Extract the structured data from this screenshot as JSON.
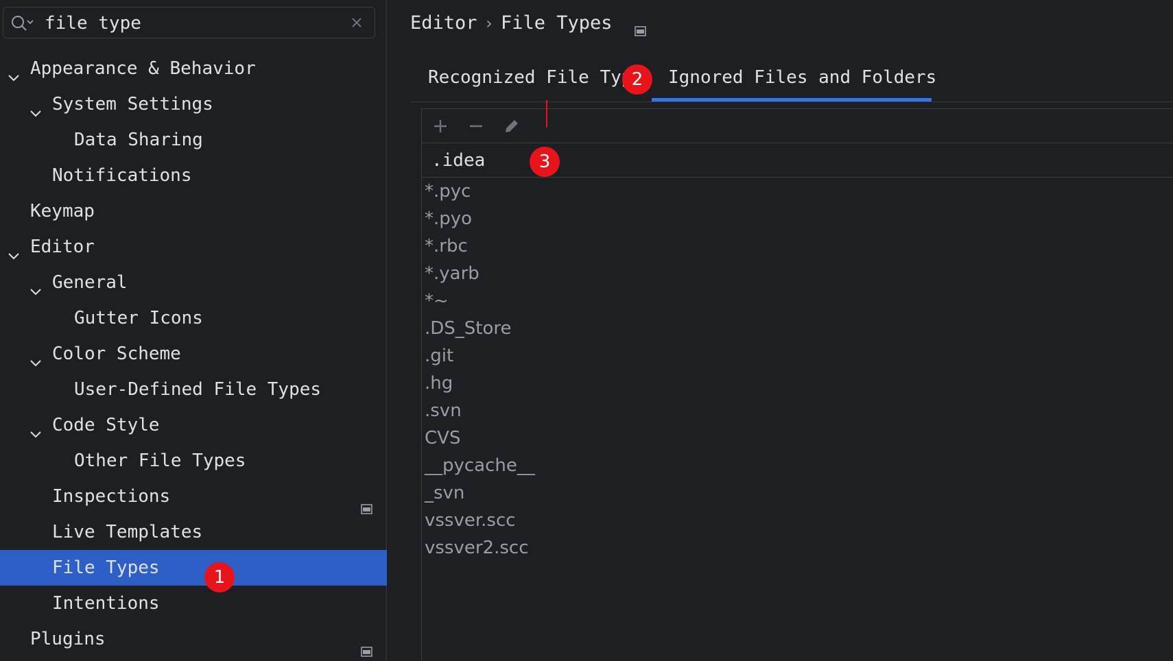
{
  "search": {
    "value": "file type",
    "icon": "search-icon"
  },
  "tree": {
    "items": [
      {
        "label": "Appearance & Behavior",
        "level": 0,
        "expanded": true
      },
      {
        "label": "System Settings",
        "level": 1,
        "expanded": true
      },
      {
        "label": "Data Sharing",
        "level": 2
      },
      {
        "label": "Notifications",
        "level": 1
      },
      {
        "label": "Keymap",
        "level": 0
      },
      {
        "label": "Editor",
        "level": 0,
        "expanded": true
      },
      {
        "label": "General",
        "level": 1,
        "expanded": true
      },
      {
        "label": "Gutter Icons",
        "level": 2
      },
      {
        "label": "Color Scheme",
        "level": 1,
        "expanded": true
      },
      {
        "label": "User-Defined File Types",
        "level": 2
      },
      {
        "label": "Code Style",
        "level": 1,
        "expanded": true
      },
      {
        "label": "Other File Types",
        "level": 2
      },
      {
        "label": "Inspections",
        "level": 1,
        "pinned": true
      },
      {
        "label": "Live Templates",
        "level": 1
      },
      {
        "label": "File Types",
        "level": 1,
        "selected": true
      },
      {
        "label": "Intentions",
        "level": 1
      },
      {
        "label": "Plugins",
        "level": 0,
        "pinned": true
      }
    ]
  },
  "breadcrumb": {
    "parent": "Editor",
    "separator": "›",
    "current": "File Types"
  },
  "tabs": [
    {
      "label": "Recognized File Types",
      "active": false
    },
    {
      "label": "Ignored Files and Folders",
      "active": true
    }
  ],
  "editor": {
    "value": ".idea"
  },
  "ignored_items": [
    "*.pyc",
    "*.pyo",
    "*.rbc",
    "*.yarb",
    "*~",
    ".DS_Store",
    ".git",
    ".hg",
    ".svn",
    "CVS",
    "__pycache__",
    "_svn",
    "vssver.scc",
    "vssver2.scc"
  ],
  "markers": [
    "1",
    "2",
    "3"
  ],
  "colors": {
    "selection": "#2e5fc7",
    "tab_underline": "#3574f0",
    "marker": "#e8141b"
  }
}
